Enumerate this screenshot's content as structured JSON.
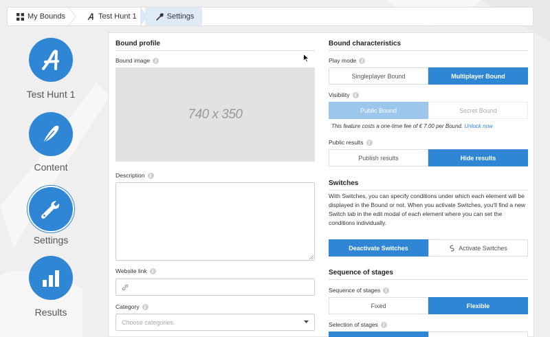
{
  "colors": {
    "accent": "#2e86d4",
    "accent_light": "#9dc6ec",
    "bg": "#efefef"
  },
  "breadcrumb": [
    {
      "label": "My Bounds",
      "icon": "grid-icon"
    },
    {
      "label": "Test Hunt 1",
      "icon": "app-logo-icon"
    },
    {
      "label": "Settings",
      "icon": "wrench-icon"
    }
  ],
  "nav": [
    {
      "label": "Test Hunt 1",
      "icon": "app-logo-icon"
    },
    {
      "label": "Content",
      "icon": "feather-icon"
    },
    {
      "label": "Settings",
      "icon": "wrench-icon"
    },
    {
      "label": "Results",
      "icon": "bar-chart-icon"
    }
  ],
  "profile": {
    "title": "Bound profile",
    "image_label": "Bound image",
    "image_placeholder": "740 x 350",
    "description_label": "Description",
    "website_label": "Website link",
    "category_label": "Category",
    "category_placeholder": "Choose categories."
  },
  "characteristics": {
    "title": "Bound characteristics",
    "play_mode": {
      "label": "Play mode",
      "options": [
        "Singleplayer Bound",
        "Multiplayer Bound"
      ],
      "selected": "Multiplayer Bound"
    },
    "visibility": {
      "label": "Visibility",
      "options": [
        "Public Bound",
        "Secret Bound"
      ],
      "selected": "Public Bound"
    },
    "fee_note": "This feature costs a one-time fee of € 7.00 per Bound.",
    "fee_link": "Unlock now",
    "public_results": {
      "label": "Public results",
      "options": [
        "Publish results",
        "Hide results"
      ],
      "selected": "Hide results"
    }
  },
  "switches": {
    "title": "Switches",
    "description": "With Switches, you can specify conditions under which each element will be displayed in the Bound or not. When you activate Switches, you'll find a new Switch tab in the edit modal of each element where you can set the conditions individually.",
    "options": [
      "Deactivate Switches",
      "Activate Switches"
    ],
    "selected": "Deactivate Switches"
  },
  "sequence": {
    "title": "Sequence of stages",
    "sequence_label": "Sequence of stages",
    "options": [
      "Fixed",
      "Flexible"
    ],
    "selected": "Flexible",
    "selection_label": "Selection of stages"
  }
}
